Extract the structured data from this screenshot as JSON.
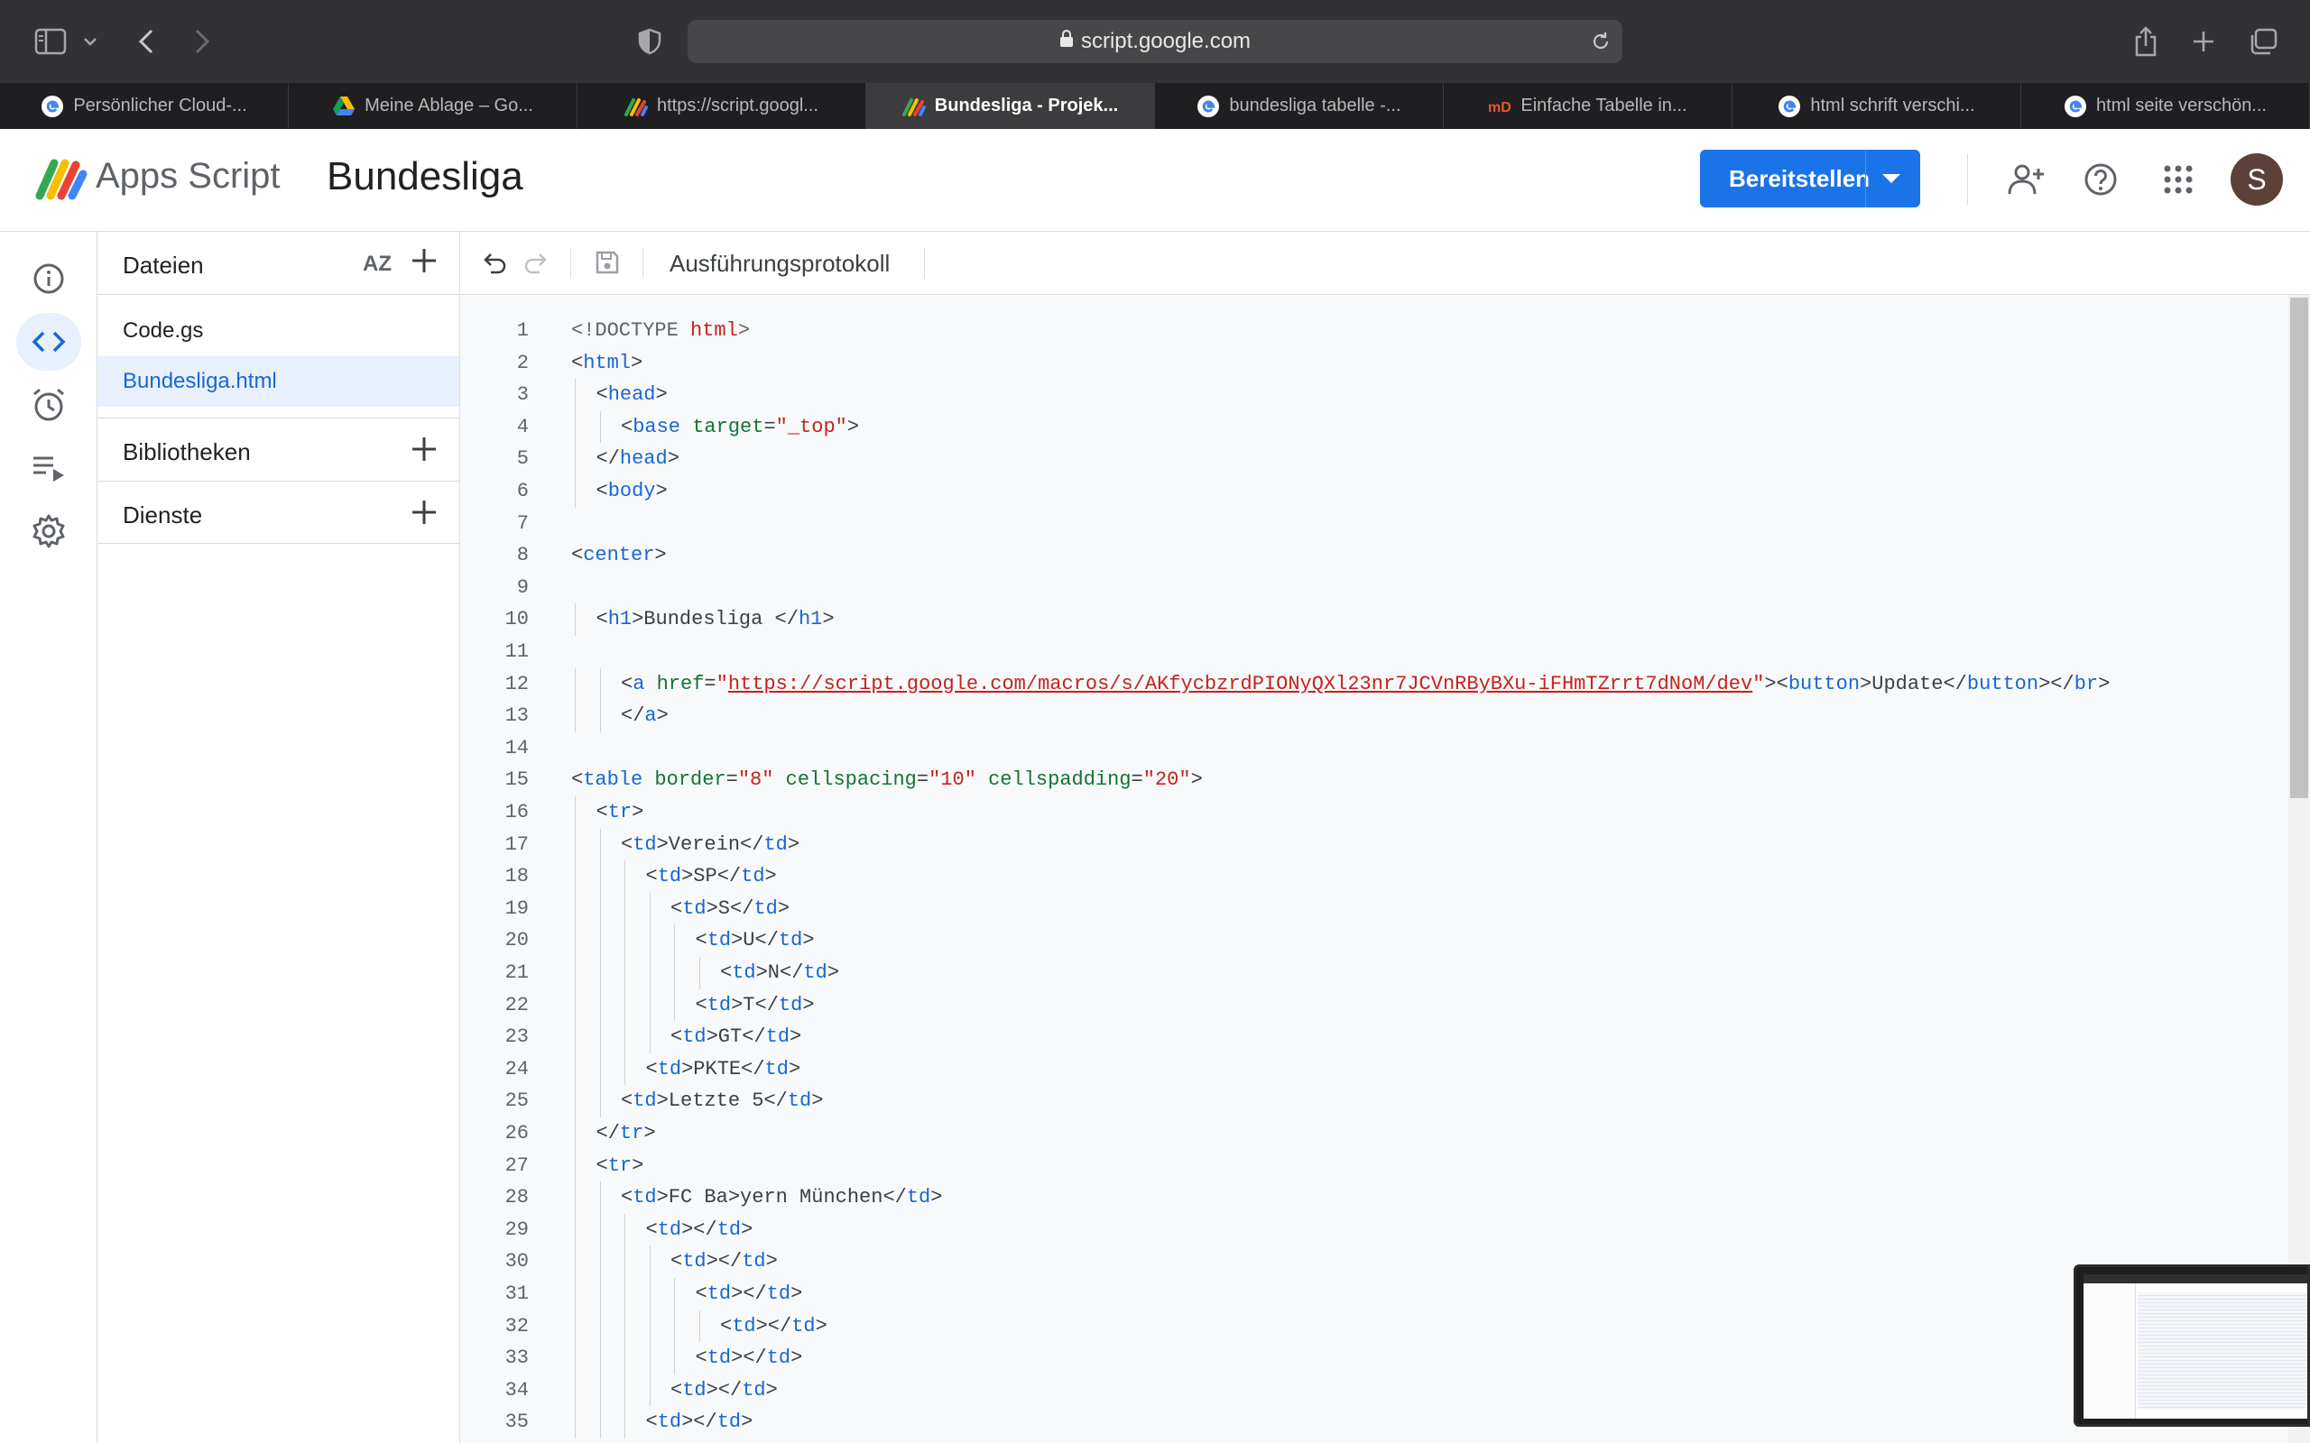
{
  "browser": {
    "url": "script.google.com",
    "tabs": [
      {
        "label": "Persönlicher Cloud-...",
        "favicon": "google-icon"
      },
      {
        "label": "Meine Ablage – Go...",
        "favicon": "google-drive-icon"
      },
      {
        "label": "https://script.googl...",
        "favicon": "apps-script-icon"
      },
      {
        "label": "Bundesliga - Projek...",
        "favicon": "apps-script-icon",
        "active": true
      },
      {
        "label": "bundesliga tabelle -...",
        "favicon": "google-icon"
      },
      {
        "label": "Einfache Tabelle in...",
        "favicon": "html-icon"
      },
      {
        "label": "html schrift verschi...",
        "favicon": "google-icon"
      },
      {
        "label": "html seite verschön...",
        "favicon": "google-icon"
      }
    ]
  },
  "header": {
    "app_name": "Apps Script",
    "project_name": "Bundesliga",
    "deploy_label": "Bereitstellen",
    "avatar_letter": "S",
    "accent_color": "#1a73e8"
  },
  "files_panel": {
    "title": "Dateien",
    "sort_label": "AZ",
    "files": [
      {
        "name": "Code.gs"
      },
      {
        "name": "Bundesliga.html",
        "active": true
      }
    ],
    "sections": [
      {
        "title": "Bibliotheken"
      },
      {
        "title": "Dienste"
      }
    ]
  },
  "editor": {
    "toolbar_label": "Ausführungsprotokoll",
    "lines": [
      {
        "n": "1",
        "indent": 0,
        "html": "<span class=\"dt\">&lt;!DOCTYPE </span><span class=\"s\">html</span><span class=\"dt\">&gt;</span>"
      },
      {
        "n": "2",
        "indent": 0,
        "html": "&lt;<span class=\"t\">html</span>&gt;"
      },
      {
        "n": "3",
        "indent": 1,
        "html": "&lt;<span class=\"t\">head</span>&gt;"
      },
      {
        "n": "4",
        "indent": 2,
        "html": "&lt;<span class=\"t\">base</span> <span class=\"a\">target</span>=<span class=\"s\">\"_top\"</span>&gt;"
      },
      {
        "n": "5",
        "indent": 1,
        "html": "&lt;/<span class=\"t\">head</span>&gt;"
      },
      {
        "n": "6",
        "indent": 1,
        "html": "&lt;<span class=\"t\">body</span>&gt;"
      },
      {
        "n": "7",
        "indent": 0,
        "html": ""
      },
      {
        "n": "8",
        "indent": 0,
        "html": "&lt;<span class=\"t\">center</span>&gt;"
      },
      {
        "n": "9",
        "indent": 0,
        "html": ""
      },
      {
        "n": "10",
        "indent": 1,
        "html": "&lt;<span class=\"t\">h1</span>&gt;Bundesliga &lt;/<span class=\"t\">h1</span>&gt;"
      },
      {
        "n": "11",
        "indent": 0,
        "html": ""
      },
      {
        "n": "12",
        "indent": 2,
        "html": "&lt;<span class=\"t\">a</span> <span class=\"a\">href</span>=<span class=\"s\">\"</span><span class=\"u\">https://script.google.com/macros/s/AKfycbzrdPIONyQXl23nr7JCVnRByBXu-iFHmTZrrt7dNoM/dev</span><span class=\"s\">\"</span>&gt;&lt;<span class=\"t\">button</span>&gt;Update&lt;/<span class=\"t\">button</span>&gt;&lt;/<span class=\"t\">br</span>&gt;"
      },
      {
        "n": "13",
        "indent": 2,
        "html": "&lt;/<span class=\"t\">a</span>&gt;"
      },
      {
        "n": "14",
        "indent": 0,
        "html": ""
      },
      {
        "n": "15",
        "indent": 0,
        "html": "&lt;<span class=\"t\">table</span> <span class=\"a\">border</span>=<span class=\"s\">\"8\"</span> <span class=\"a\">cellspacing</span>=<span class=\"s\">\"10\"</span> <span class=\"a\">cellspadding</span>=<span class=\"s\">\"20\"</span>&gt;"
      },
      {
        "n": "16",
        "indent": 1,
        "html": "&lt;<span class=\"t\">tr</span>&gt;"
      },
      {
        "n": "17",
        "indent": 2,
        "html": "&lt;<span class=\"t\">td</span>&gt;Verein&lt;/<span class=\"t\">td</span>&gt;"
      },
      {
        "n": "18",
        "indent": 3,
        "html": "&lt;<span class=\"t\">td</span>&gt;SP&lt;/<span class=\"t\">td</span>&gt;"
      },
      {
        "n": "19",
        "indent": 4,
        "html": "&lt;<span class=\"t\">td</span>&gt;S&lt;/<span class=\"t\">td</span>&gt;"
      },
      {
        "n": "20",
        "indent": 5,
        "html": "&lt;<span class=\"t\">td</span>&gt;U&lt;/<span class=\"t\">td</span>&gt;"
      },
      {
        "n": "21",
        "indent": 6,
        "html": "&lt;<span class=\"t\">td</span>&gt;N&lt;/<span class=\"t\">td</span>&gt;"
      },
      {
        "n": "22",
        "indent": 5,
        "html": "&lt;<span class=\"t\">td</span>&gt;T&lt;/<span class=\"t\">td</span>&gt;"
      },
      {
        "n": "23",
        "indent": 4,
        "html": "&lt;<span class=\"t\">td</span>&gt;GT&lt;/<span class=\"t\">td</span>&gt;"
      },
      {
        "n": "24",
        "indent": 3,
        "html": "&lt;<span class=\"t\">td</span>&gt;PKTE&lt;/<span class=\"t\">td</span>&gt;"
      },
      {
        "n": "25",
        "indent": 2,
        "html": "&lt;<span class=\"t\">td</span>&gt;Letzte 5&lt;/<span class=\"t\">td</span>&gt;"
      },
      {
        "n": "26",
        "indent": 1,
        "html": "&lt;/<span class=\"t\">tr</span>&gt;"
      },
      {
        "n": "27",
        "indent": 1,
        "html": "&lt;<span class=\"t\">tr</span>&gt;"
      },
      {
        "n": "28",
        "indent": 2,
        "html": "&lt;<span class=\"t\">td</span>&gt;FC Ba&gt;yern München&lt;/<span class=\"t\">td</span>&gt;"
      },
      {
        "n": "29",
        "indent": 3,
        "html": "&lt;<span class=\"t\">td</span>&gt;&lt;/<span class=\"t\">td</span>&gt;"
      },
      {
        "n": "30",
        "indent": 4,
        "html": "&lt;<span class=\"t\">td</span>&gt;&lt;/<span class=\"t\">td</span>&gt;"
      },
      {
        "n": "31",
        "indent": 5,
        "html": "&lt;<span class=\"t\">td</span>&gt;&lt;/<span class=\"t\">td</span>&gt;"
      },
      {
        "n": "32",
        "indent": 6,
        "html": "&lt;<span class=\"t\">td</span>&gt;&lt;/<span class=\"t\">td</span>&gt;"
      },
      {
        "n": "33",
        "indent": 5,
        "html": "&lt;<span class=\"t\">td</span>&gt;&lt;/<span class=\"t\">td</span>&gt;"
      },
      {
        "n": "34",
        "indent": 4,
        "html": "&lt;<span class=\"t\">td</span>&gt;&lt;/<span class=\"t\">td</span>&gt;"
      },
      {
        "n": "35",
        "indent": 3,
        "html": "&lt;<span class=\"t\">td</span>&gt;&lt;/<span class=\"t\">td</span>&gt;"
      }
    ]
  }
}
